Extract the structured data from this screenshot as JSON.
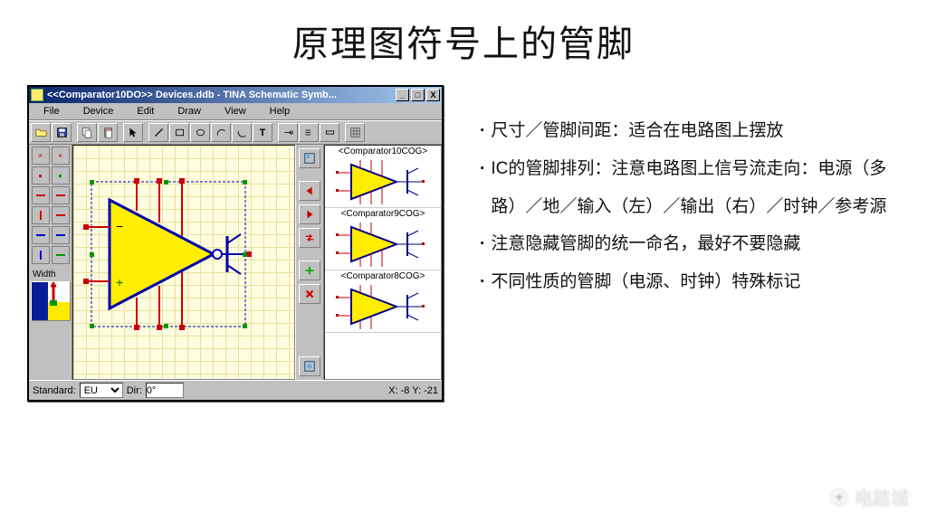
{
  "slide": {
    "title": "原理图符号上的管脚"
  },
  "window": {
    "title": "<<Comparator10DO>> Devices.ddb - TINA Schematic Symb...",
    "menus": [
      "File",
      "Device",
      "Edit",
      "Draw",
      "View",
      "Help"
    ]
  },
  "left_panel": {
    "width_label": "Width"
  },
  "symbols": [
    {
      "name": "Comparator10COG"
    },
    {
      "name": "Comparator9COG"
    },
    {
      "name": "Comparator8COG"
    }
  ],
  "status": {
    "standard_label": "Standard:",
    "standard_value": "EU",
    "dir_label": "Dir:",
    "dir_value": "0°",
    "coords": "X: -8 Y: -21"
  },
  "bullets": [
    "尺寸／管脚间距：适合在电路图上摆放",
    "IC的管脚排列：注意电路图上信号流走向：电源（多路）／地／输入（左）／输出（右）／时钟／参考源",
    "注意隐藏管脚的统一命名，最好不要隐藏",
    "不同性质的管脚（电源、时钟）特殊标记"
  ],
  "watermark": "电路城"
}
